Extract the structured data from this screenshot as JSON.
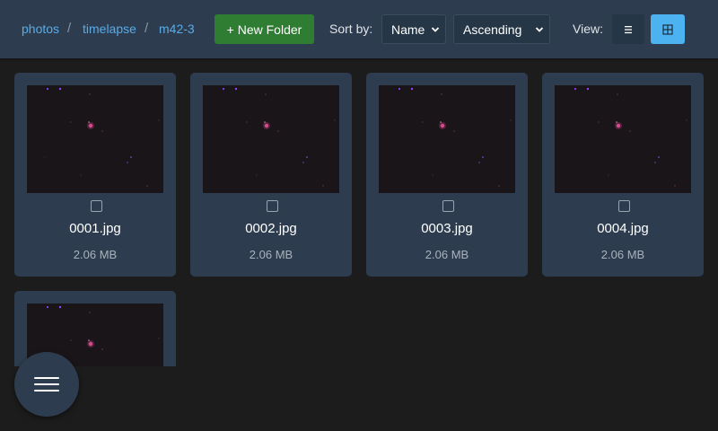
{
  "breadcrumb": {
    "items": [
      "photos",
      "timelapse",
      "m42-3"
    ],
    "separator": "/"
  },
  "toolbar": {
    "new_folder_label": "+ New Folder",
    "sort_by_label": "Sort by:",
    "sort_field": "Name",
    "sort_order": "Ascending",
    "view_label": "View:",
    "view_mode": "grid"
  },
  "files": [
    {
      "name": "0001.jpg",
      "size": "2.06 MB"
    },
    {
      "name": "0002.jpg",
      "size": "2.06 MB"
    },
    {
      "name": "0003.jpg",
      "size": "2.06 MB"
    },
    {
      "name": "0004.jpg",
      "size": "2.06 MB"
    },
    {
      "name": "",
      "size": ""
    }
  ],
  "icons": {
    "list_view": "list-icon",
    "grid_view": "grid-icon",
    "menu": "hamburger-menu-icon"
  },
  "colors": {
    "accent": "#4db3f0",
    "new_folder": "#2e7d32",
    "card": "#2d3d4f",
    "link": "#5aabe8"
  }
}
